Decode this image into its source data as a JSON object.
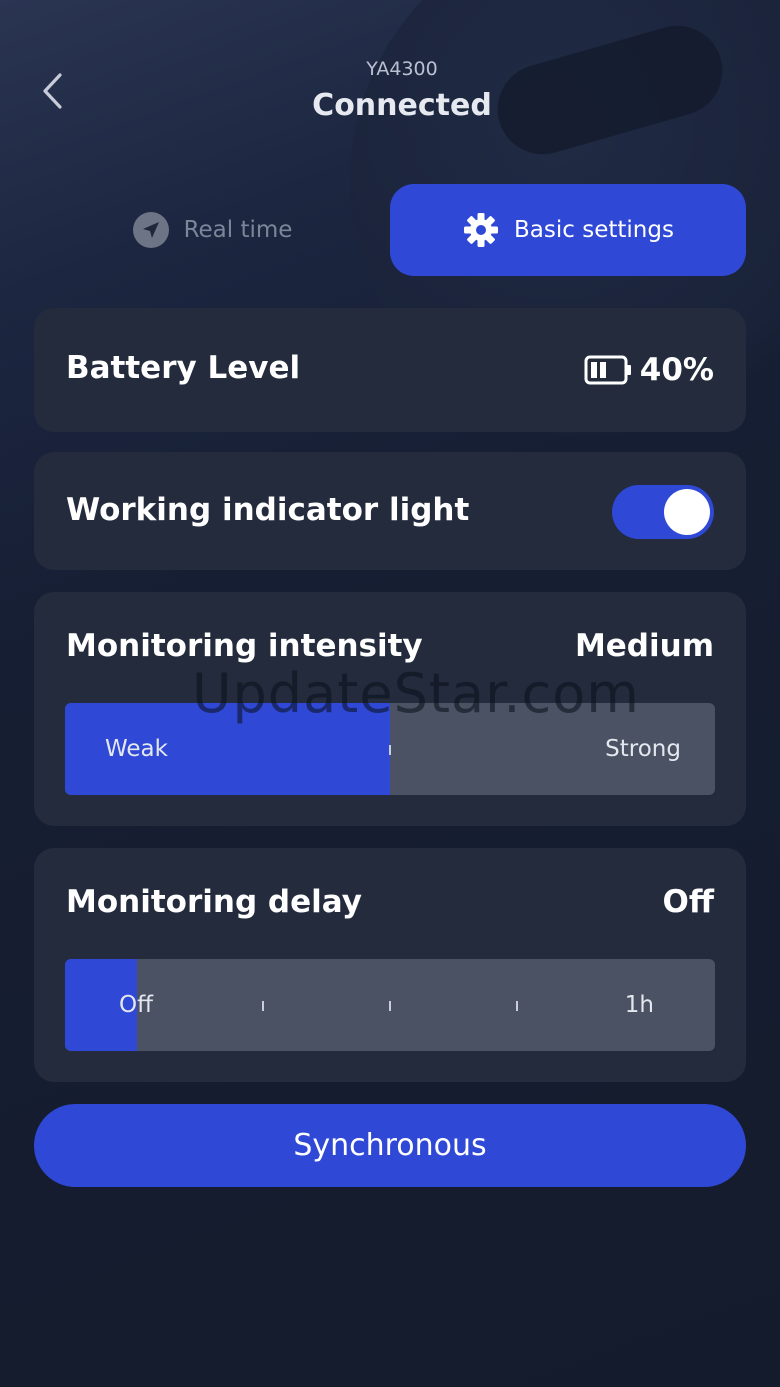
{
  "header": {
    "device_name": "YA4300",
    "status": "Connected",
    "back_icon": "chevron-left-icon"
  },
  "tabs": [
    {
      "label": "Real time",
      "icon": "navigation-arrow-icon",
      "active": false
    },
    {
      "label": "Basic settings",
      "icon": "gear-icon",
      "active": true
    }
  ],
  "battery": {
    "label": "Battery Level",
    "value": "40%",
    "level": 0.4,
    "icon": "battery-icon"
  },
  "indicator_light": {
    "label": "Working indicator light",
    "enabled": true
  },
  "intensity": {
    "label": "Monitoring intensity",
    "value": "Medium",
    "min_label": "Weak",
    "max_label": "Strong",
    "level": 0.5
  },
  "delay": {
    "label": "Monitoring delay",
    "value": "Off",
    "min_label": "Off",
    "max_label": "1h",
    "level": 0
  },
  "sync_button": {
    "label": "Synchronous"
  },
  "watermark": "UpdateStar.com",
  "colors": {
    "accent": "#2f49d6",
    "card": "#232b3d",
    "track": "#4a5263",
    "background": "#141b2c"
  }
}
